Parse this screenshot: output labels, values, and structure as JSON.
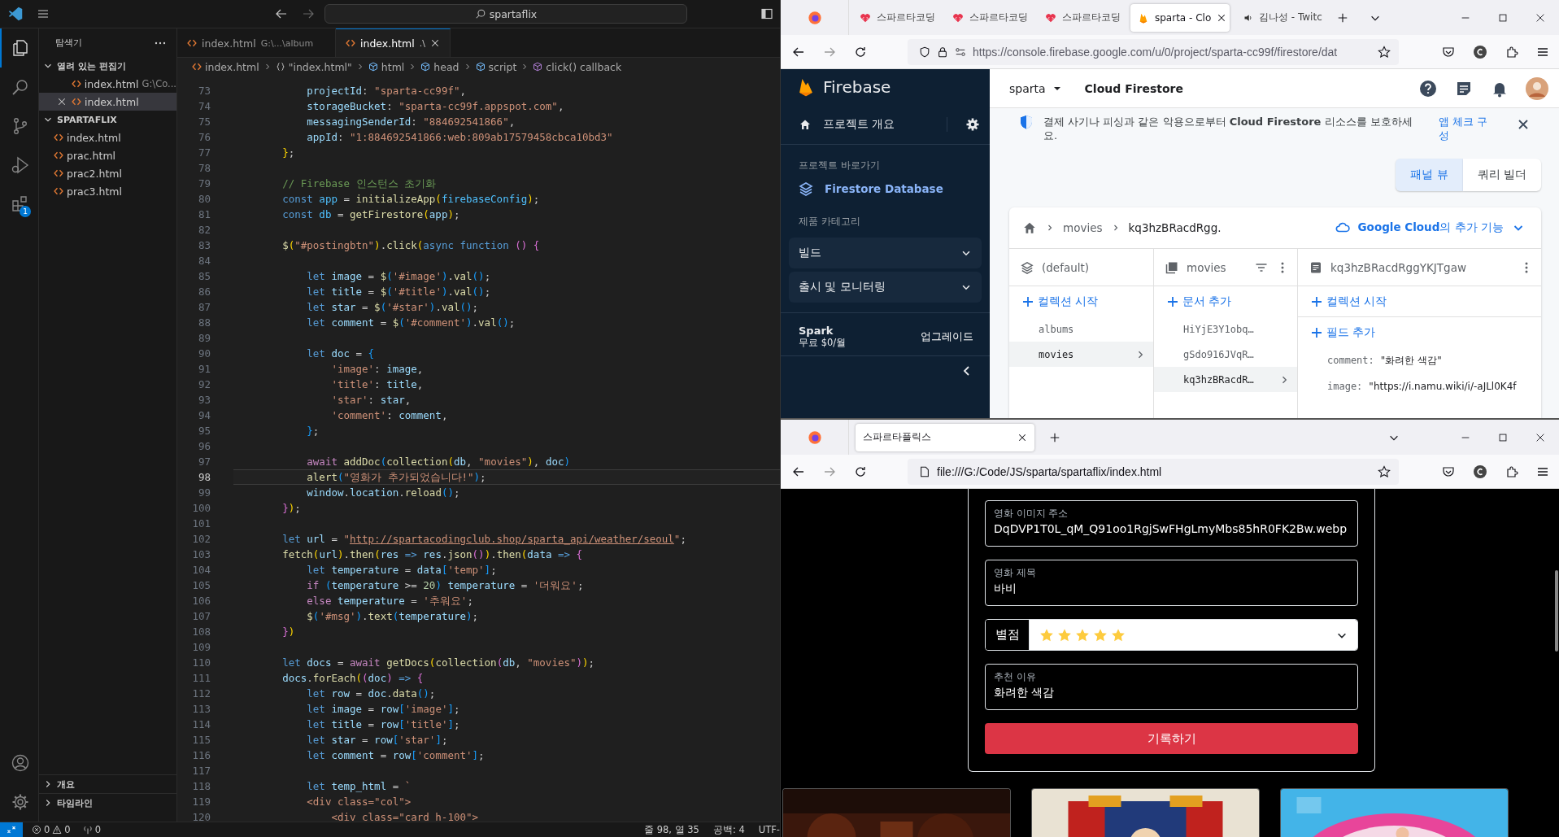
{
  "vscode": {
    "title_bar": {
      "search": "spartaflix"
    },
    "activity_bar": [
      {
        "kind": "explorer",
        "selected": true
      },
      {
        "kind": "search",
        "selected": false
      },
      {
        "kind": "source-control",
        "selected": false
      },
      {
        "kind": "run-debug",
        "selected": false
      },
      {
        "kind": "extensions",
        "selected": false,
        "badge": "1"
      }
    ],
    "activity_bar_bottom": [
      {
        "kind": "account"
      },
      {
        "kind": "settings"
      }
    ],
    "explorer": {
      "title": "탐색기",
      "open_editors": {
        "label": "열려 있는 편집기",
        "expanded": true,
        "items": [
          {
            "name": "index.html",
            "path": "G:\\Co...",
            "selected": false
          },
          {
            "name": "index.html",
            "selected": true
          }
        ]
      },
      "folder": {
        "label": "SPARTAFLIX",
        "expanded": true,
        "files": [
          "index.html",
          "prac.html",
          "prac2.html",
          "prac3.html"
        ]
      },
      "bottom_sections": [
        {
          "label": "개요",
          "expanded": false
        },
        {
          "label": "타임라인",
          "expanded": false
        }
      ]
    },
    "tabs": [
      {
        "name": "index.html",
        "path": "G:\\...\\album",
        "selected": false
      },
      {
        "name": "index.html",
        "path": ".\\",
        "selected": true
      }
    ],
    "breadcrumbs": [
      {
        "kind": "file",
        "label": "index.html"
      },
      {
        "kind": "object",
        "label": "\"index.html\""
      },
      {
        "kind": "element",
        "label": "html"
      },
      {
        "kind": "element",
        "label": "head"
      },
      {
        "kind": "element",
        "label": "script"
      },
      {
        "kind": "method",
        "label": "click() callback"
      }
    ],
    "code": [
      {
        "number": "73",
        "current": false,
        "tokens": [
          {
            "kind": "var",
            "text": "            projectId"
          },
          {
            "kind": "p",
            "text": ": "
          },
          {
            "kind": "str",
            "text": "\"sparta-cc99f\""
          },
          {
            "kind": "p",
            "text": ","
          }
        ]
      },
      {
        "number": "74",
        "current": false,
        "tokens": [
          {
            "kind": "var",
            "text": "            storageBucket"
          },
          {
            "kind": "p",
            "text": ": "
          },
          {
            "kind": "str",
            "text": "\"sparta-cc99f.appspot.com\""
          },
          {
            "kind": "p",
            "text": ","
          }
        ]
      },
      {
        "number": "75",
        "current": false,
        "tokens": [
          {
            "kind": "var",
            "text": "            messagingSenderId"
          },
          {
            "kind": "p",
            "text": ": "
          },
          {
            "kind": "str",
            "text": "\"884692541866\""
          },
          {
            "kind": "p",
            "text": ","
          }
        ]
      },
      {
        "number": "76",
        "current": false,
        "tokens": [
          {
            "kind": "var",
            "text": "            appId"
          },
          {
            "kind": "p",
            "text": ": "
          },
          {
            "kind": "str",
            "text": "\"1:884692541866:web:809ab17579458cbca10bd3\""
          }
        ]
      },
      {
        "number": "77",
        "current": false,
        "tokens": [
          {
            "kind": "b1",
            "text": "        }"
          },
          {
            "kind": "p",
            "text": ";"
          }
        ]
      },
      {
        "number": "78",
        "current": false
      },
      {
        "number": "79",
        "current": false,
        "tokens": [
          {
            "kind": "com",
            "text": "        // Firebase 인스턴스 초기화"
          }
        ]
      },
      {
        "number": "80",
        "current": false,
        "tokens": [
          {
            "kind": "kw",
            "text": "        const "
          },
          {
            "kind": "cst",
            "text": "app"
          },
          {
            "kind": "p",
            "text": " = "
          },
          {
            "kind": "fn",
            "text": "initializeApp"
          },
          {
            "kind": "b1",
            "text": "("
          },
          {
            "kind": "cst",
            "text": "firebaseConfig"
          },
          {
            "kind": "b1",
            "text": ")"
          },
          {
            "kind": "p",
            "text": ";"
          }
        ]
      },
      {
        "number": "81",
        "current": false,
        "tokens": [
          {
            "kind": "kw",
            "text": "        const "
          },
          {
            "kind": "cst",
            "text": "db"
          },
          {
            "kind": "p",
            "text": " = "
          },
          {
            "kind": "fn",
            "text": "getFirestore"
          },
          {
            "kind": "b1",
            "text": "("
          },
          {
            "kind": "var",
            "text": "app"
          },
          {
            "kind": "b1",
            "text": ")"
          },
          {
            "kind": "p",
            "text": ";"
          }
        ]
      },
      {
        "number": "82",
        "current": false
      },
      {
        "number": "83",
        "current": false,
        "tokens": [
          {
            "kind": "fn",
            "text": "        $"
          },
          {
            "kind": "b1",
            "text": "("
          },
          {
            "kind": "str",
            "text": "\"#postingbtn\""
          },
          {
            "kind": "b1",
            "text": ")"
          },
          {
            "kind": "p",
            "text": "."
          },
          {
            "kind": "fn",
            "text": "click"
          },
          {
            "kind": "b1",
            "text": "("
          },
          {
            "kind": "kw",
            "text": "async function "
          },
          {
            "kind": "b2",
            "text": "() {"
          }
        ]
      },
      {
        "number": "84",
        "current": false
      },
      {
        "number": "85",
        "current": false,
        "tokens": [
          {
            "kind": "kw",
            "text": "            let "
          },
          {
            "kind": "var",
            "text": "image"
          },
          {
            "kind": "p",
            "text": " = "
          },
          {
            "kind": "fn",
            "text": "$"
          },
          {
            "kind": "b3",
            "text": "("
          },
          {
            "kind": "str",
            "text": "'#image'"
          },
          {
            "kind": "b3",
            "text": ")"
          },
          {
            "kind": "p",
            "text": "."
          },
          {
            "kind": "fn",
            "text": "val"
          },
          {
            "kind": "b3",
            "text": "()"
          },
          {
            "kind": "p",
            "text": ";"
          }
        ]
      },
      {
        "number": "86",
        "current": false,
        "tokens": [
          {
            "kind": "kw",
            "text": "            let "
          },
          {
            "kind": "var",
            "text": "title"
          },
          {
            "kind": "p",
            "text": " = "
          },
          {
            "kind": "fn",
            "text": "$"
          },
          {
            "kind": "b3",
            "text": "("
          },
          {
            "kind": "str",
            "text": "'#title'"
          },
          {
            "kind": "b3",
            "text": ")"
          },
          {
            "kind": "p",
            "text": "."
          },
          {
            "kind": "fn",
            "text": "val"
          },
          {
            "kind": "b3",
            "text": "()"
          },
          {
            "kind": "p",
            "text": ";"
          }
        ]
      },
      {
        "number": "87",
        "current": false,
        "tokens": [
          {
            "kind": "kw",
            "text": "            let "
          },
          {
            "kind": "var",
            "text": "star"
          },
          {
            "kind": "p",
            "text": " = "
          },
          {
            "kind": "fn",
            "text": "$"
          },
          {
            "kind": "b3",
            "text": "("
          },
          {
            "kind": "str",
            "text": "'#star'"
          },
          {
            "kind": "b3",
            "text": ")"
          },
          {
            "kind": "p",
            "text": "."
          },
          {
            "kind": "fn",
            "text": "val"
          },
          {
            "kind": "b3",
            "text": "()"
          },
          {
            "kind": "p",
            "text": ";"
          }
        ]
      },
      {
        "number": "88",
        "current": false,
        "tokens": [
          {
            "kind": "kw",
            "text": "            let "
          },
          {
            "kind": "var",
            "text": "comment"
          },
          {
            "kind": "p",
            "text": " = "
          },
          {
            "kind": "fn",
            "text": "$"
          },
          {
            "kind": "b3",
            "text": "("
          },
          {
            "kind": "str",
            "text": "'#comment'"
          },
          {
            "kind": "b3",
            "text": ")"
          },
          {
            "kind": "p",
            "text": "."
          },
          {
            "kind": "fn",
            "text": "val"
          },
          {
            "kind": "b3",
            "text": "()"
          },
          {
            "kind": "p",
            "text": ";"
          }
        ]
      },
      {
        "number": "89",
        "current": false
      },
      {
        "number": "90",
        "current": false,
        "tokens": [
          {
            "kind": "kw",
            "text": "            let "
          },
          {
            "kind": "var",
            "text": "doc"
          },
          {
            "kind": "p",
            "text": " = "
          },
          {
            "kind": "b3",
            "text": "{"
          }
        ]
      },
      {
        "number": "91",
        "current": false,
        "tokens": [
          {
            "kind": "str",
            "text": "                'image'"
          },
          {
            "kind": "p",
            "text": ": "
          },
          {
            "kind": "var",
            "text": "image"
          },
          {
            "kind": "p",
            "text": ","
          }
        ]
      },
      {
        "number": "92",
        "current": false,
        "tokens": [
          {
            "kind": "str",
            "text": "                'title'"
          },
          {
            "kind": "p",
            "text": ": "
          },
          {
            "kind": "var",
            "text": "title"
          },
          {
            "kind": "p",
            "text": ","
          }
        ]
      },
      {
        "number": "93",
        "current": false,
        "tokens": [
          {
            "kind": "str",
            "text": "                'star'"
          },
          {
            "kind": "p",
            "text": ": "
          },
          {
            "kind": "var",
            "text": "star"
          },
          {
            "kind": "p",
            "text": ","
          }
        ]
      },
      {
        "number": "94",
        "current": false,
        "tokens": [
          {
            "kind": "str",
            "text": "                'comment'"
          },
          {
            "kind": "p",
            "text": ": "
          },
          {
            "kind": "var",
            "text": "comment"
          },
          {
            "kind": "p",
            "text": ","
          }
        ]
      },
      {
        "number": "95",
        "current": false,
        "tokens": [
          {
            "kind": "b3",
            "text": "            }"
          },
          {
            "kind": "p",
            "text": ";"
          }
        ]
      },
      {
        "number": "96",
        "current": false
      },
      {
        "number": "97",
        "current": false,
        "tokens": [
          {
            "kind": "ctl",
            "text": "            await "
          },
          {
            "kind": "fn",
            "text": "addDoc"
          },
          {
            "kind": "b3",
            "text": "("
          },
          {
            "kind": "fn",
            "text": "collection"
          },
          {
            "kind": "b1",
            "text": "("
          },
          {
            "kind": "var",
            "text": "db"
          },
          {
            "kind": "p",
            "text": ", "
          },
          {
            "kind": "str",
            "text": "\"movies\""
          },
          {
            "kind": "b1",
            "text": ")"
          },
          {
            "kind": "p",
            "text": ", "
          },
          {
            "kind": "var",
            "text": "doc"
          },
          {
            "kind": "b3",
            "text": ")"
          }
        ]
      },
      {
        "number": "98",
        "current": true,
        "tokens": [
          {
            "kind": "fn",
            "text": "            alert"
          },
          {
            "kind": "b3",
            "text": "("
          },
          {
            "kind": "str",
            "text": "\"영화가 추가되었습니다!\""
          },
          {
            "kind": "b3",
            "text": ")"
          },
          {
            "kind": "p",
            "text": ";"
          }
        ]
      },
      {
        "number": "99",
        "current": false,
        "tokens": [
          {
            "kind": "var",
            "text": "            window"
          },
          {
            "kind": "p",
            "text": "."
          },
          {
            "kind": "var",
            "text": "location"
          },
          {
            "kind": "p",
            "text": "."
          },
          {
            "kind": "fn",
            "text": "reload"
          },
          {
            "kind": "b3",
            "text": "()"
          },
          {
            "kind": "p",
            "text": ";"
          }
        ]
      },
      {
        "number": "100",
        "current": false,
        "tokens": [
          {
            "kind": "b2",
            "text": "        }"
          },
          {
            "kind": "b1",
            "text": ")"
          },
          {
            "kind": "p",
            "text": ";"
          }
        ]
      },
      {
        "number": "101",
        "current": false
      },
      {
        "number": "102",
        "current": false,
        "tokens": [
          {
            "kind": "kw",
            "text": "        let "
          },
          {
            "kind": "var",
            "text": "url"
          },
          {
            "kind": "p",
            "text": " = "
          },
          {
            "kind": "str",
            "text": "\""
          },
          {
            "kind": "url",
            "text": "http://spartacodingclub.shop/sparta_api/weather/seoul"
          },
          {
            "kind": "str",
            "text": "\""
          },
          {
            "kind": "p",
            "text": ";"
          }
        ]
      },
      {
        "number": "103",
        "current": false,
        "tokens": [
          {
            "kind": "fn",
            "text": "        fetch"
          },
          {
            "kind": "b1",
            "text": "("
          },
          {
            "kind": "var",
            "text": "url"
          },
          {
            "kind": "b1",
            "text": ")"
          },
          {
            "kind": "p",
            "text": "."
          },
          {
            "kind": "fn",
            "text": "then"
          },
          {
            "kind": "b1",
            "text": "("
          },
          {
            "kind": "var",
            "text": "res"
          },
          {
            "kind": "kw",
            "text": " => "
          },
          {
            "kind": "var",
            "text": "res"
          },
          {
            "kind": "p",
            "text": "."
          },
          {
            "kind": "fn",
            "text": "json"
          },
          {
            "kind": "b2",
            "text": "()"
          },
          {
            "kind": "b1",
            "text": ")"
          },
          {
            "kind": "p",
            "text": "."
          },
          {
            "kind": "fn",
            "text": "then"
          },
          {
            "kind": "b1",
            "text": "("
          },
          {
            "kind": "var",
            "text": "data"
          },
          {
            "kind": "kw",
            "text": " => "
          },
          {
            "kind": "b2",
            "text": "{"
          }
        ]
      },
      {
        "number": "104",
        "current": false,
        "tokens": [
          {
            "kind": "kw",
            "text": "            let "
          },
          {
            "kind": "var",
            "text": "temperature"
          },
          {
            "kind": "p",
            "text": " = "
          },
          {
            "kind": "var",
            "text": "data"
          },
          {
            "kind": "b3",
            "text": "["
          },
          {
            "kind": "str",
            "text": "'temp'"
          },
          {
            "kind": "b3",
            "text": "]"
          },
          {
            "kind": "p",
            "text": ";"
          }
        ]
      },
      {
        "number": "105",
        "current": false,
        "tokens": [
          {
            "kind": "ctl",
            "text": "            if "
          },
          {
            "kind": "b3",
            "text": "("
          },
          {
            "kind": "var",
            "text": "temperature"
          },
          {
            "kind": "p",
            "text": " >= "
          },
          {
            "kind": "num",
            "text": "20"
          },
          {
            "kind": "b3",
            "text": ")"
          },
          {
            "kind": "var",
            "text": " temperature"
          },
          {
            "kind": "p",
            "text": " = "
          },
          {
            "kind": "str",
            "text": "'더워요'"
          },
          {
            "kind": "p",
            "text": ";"
          }
        ]
      },
      {
        "number": "106",
        "current": false,
        "tokens": [
          {
            "kind": "ctl",
            "text": "            else "
          },
          {
            "kind": "var",
            "text": "temperature"
          },
          {
            "kind": "p",
            "text": " = "
          },
          {
            "kind": "str",
            "text": "'추워요'"
          },
          {
            "kind": "p",
            "text": ";"
          }
        ]
      },
      {
        "number": "107",
        "current": false,
        "tokens": [
          {
            "kind": "fn",
            "text": "            $"
          },
          {
            "kind": "b3",
            "text": "("
          },
          {
            "kind": "str",
            "text": "'#msg'"
          },
          {
            "kind": "b3",
            "text": ")"
          },
          {
            "kind": "p",
            "text": "."
          },
          {
            "kind": "fn",
            "text": "text"
          },
          {
            "kind": "b3",
            "text": "("
          },
          {
            "kind": "var",
            "text": "temperature"
          },
          {
            "kind": "b3",
            "text": ")"
          },
          {
            "kind": "p",
            "text": ";"
          }
        ]
      },
      {
        "number": "108",
        "current": false,
        "tokens": [
          {
            "kind": "b2",
            "text": "        }"
          },
          {
            "kind": "b1",
            "text": ")"
          }
        ]
      },
      {
        "number": "109",
        "current": false
      },
      {
        "number": "110",
        "current": false,
        "tokens": [
          {
            "kind": "kw",
            "text": "        let "
          },
          {
            "kind": "var",
            "text": "docs"
          },
          {
            "kind": "p",
            "text": " = "
          },
          {
            "kind": "ctl",
            "text": "await "
          },
          {
            "kind": "fn",
            "text": "getDocs"
          },
          {
            "kind": "b1",
            "text": "("
          },
          {
            "kind": "fn",
            "text": "collection"
          },
          {
            "kind": "b2",
            "text": "("
          },
          {
            "kind": "var",
            "text": "db"
          },
          {
            "kind": "p",
            "text": ", "
          },
          {
            "kind": "str",
            "text": "\"movies\""
          },
          {
            "kind": "b2",
            "text": ")"
          },
          {
            "kind": "b1",
            "text": ")"
          },
          {
            "kind": "p",
            "text": ";"
          }
        ]
      },
      {
        "number": "111",
        "current": false,
        "tokens": [
          {
            "kind": "var",
            "text": "        docs"
          },
          {
            "kind": "p",
            "text": "."
          },
          {
            "kind": "fn",
            "text": "forEach"
          },
          {
            "kind": "b1",
            "text": "("
          },
          {
            "kind": "b2",
            "text": "("
          },
          {
            "kind": "var",
            "text": "doc"
          },
          {
            "kind": "b2",
            "text": ")"
          },
          {
            "kind": "kw",
            "text": " => "
          },
          {
            "kind": "b2",
            "text": "{"
          }
        ]
      },
      {
        "number": "112",
        "current": false,
        "tokens": [
          {
            "kind": "kw",
            "text": "            let "
          },
          {
            "kind": "var",
            "text": "row"
          },
          {
            "kind": "p",
            "text": " = "
          },
          {
            "kind": "var",
            "text": "doc"
          },
          {
            "kind": "p",
            "text": "."
          },
          {
            "kind": "fn",
            "text": "data"
          },
          {
            "kind": "b3",
            "text": "()"
          },
          {
            "kind": "p",
            "text": ";"
          }
        ]
      },
      {
        "number": "113",
        "current": false,
        "tokens": [
          {
            "kind": "kw",
            "text": "            let "
          },
          {
            "kind": "var",
            "text": "image"
          },
          {
            "kind": "p",
            "text": " = "
          },
          {
            "kind": "var",
            "text": "row"
          },
          {
            "kind": "b3",
            "text": "["
          },
          {
            "kind": "str",
            "text": "'image'"
          },
          {
            "kind": "b3",
            "text": "]"
          },
          {
            "kind": "p",
            "text": ";"
          }
        ]
      },
      {
        "number": "114",
        "current": false,
        "tokens": [
          {
            "kind": "kw",
            "text": "            let "
          },
          {
            "kind": "var",
            "text": "title"
          },
          {
            "kind": "p",
            "text": " = "
          },
          {
            "kind": "var",
            "text": "row"
          },
          {
            "kind": "b3",
            "text": "["
          },
          {
            "kind": "str",
            "text": "'title'"
          },
          {
            "kind": "b3",
            "text": "]"
          },
          {
            "kind": "p",
            "text": ";"
          }
        ]
      },
      {
        "number": "115",
        "current": false,
        "tokens": [
          {
            "kind": "kw",
            "text": "            let "
          },
          {
            "kind": "var",
            "text": "star"
          },
          {
            "kind": "p",
            "text": " = "
          },
          {
            "kind": "var",
            "text": "row"
          },
          {
            "kind": "b3",
            "text": "["
          },
          {
            "kind": "str",
            "text": "'star'"
          },
          {
            "kind": "b3",
            "text": "]"
          },
          {
            "kind": "p",
            "text": ";"
          }
        ]
      },
      {
        "number": "116",
        "current": false,
        "tokens": [
          {
            "kind": "kw",
            "text": "            let "
          },
          {
            "kind": "var",
            "text": "comment"
          },
          {
            "kind": "p",
            "text": " = "
          },
          {
            "kind": "var",
            "text": "row"
          },
          {
            "kind": "b3",
            "text": "["
          },
          {
            "kind": "str",
            "text": "'comment'"
          },
          {
            "kind": "b3",
            "text": "]"
          },
          {
            "kind": "p",
            "text": ";"
          }
        ]
      },
      {
        "number": "117",
        "current": false
      },
      {
        "number": "118",
        "current": false,
        "tokens": [
          {
            "kind": "kw",
            "text": "            let "
          },
          {
            "kind": "var",
            "text": "temp_html"
          },
          {
            "kind": "p",
            "text": " = "
          },
          {
            "kind": "str",
            "text": "`"
          }
        ]
      },
      {
        "number": "119",
        "current": false,
        "tokens": [
          {
            "kind": "str",
            "text": "            <div class=\"col\">"
          }
        ]
      },
      {
        "number": "120",
        "current": false,
        "tokens": [
          {
            "kind": "str",
            "text": "                <div class=\"card h-100\">"
          }
        ]
      }
    ],
    "status_bar": {
      "errors": "0",
      "warnings": "0",
      "ports": "0",
      "position": "줄 98, 열 35",
      "indent": "공백: 4",
      "encoding": "UTF-"
    }
  },
  "firebase_window": {
    "tabs": [
      {
        "title": "스파르타코딩",
        "kind": "site",
        "selected": false
      },
      {
        "title": "스파르타코딩",
        "kind": "site",
        "selected": false
      },
      {
        "title": "스파르타코딩",
        "kind": "site",
        "selected": false
      },
      {
        "title": "sparta - Clo",
        "kind": "console",
        "selected": true
      },
      {
        "title": "김나성 - Twitc",
        "kind": "playing",
        "selected": false
      }
    ],
    "url": "https://console.firebase.google.com/u/0/project/sparta-cc99f/firestore/dat",
    "sidebar": {
      "brand": "Firebase",
      "overview": "프로젝트 개요",
      "shortcuts_label": "프로젝트 바로가기",
      "shortcut": "Firestore Database",
      "category_label": "제품 카테고리",
      "categories": [
        {
          "label": "빌드",
          "expanded": false
        },
        {
          "label": "출시 및 모니터링",
          "expanded": false
        }
      ],
      "plan": {
        "name": "Spark",
        "price": "무료 $0/월",
        "action": "업그레이드"
      }
    },
    "header": {
      "project": "sparta",
      "product": "Cloud Firestore"
    },
    "banner": {
      "text": "결제 사기나 피싱과 같은 악용으로부터 **Cloud Firestore** 리소스를 보호하세요.",
      "link": "앱 체크 구성"
    },
    "view_toggle": [
      {
        "label": "패널 뷰",
        "selected": true
      },
      {
        "label": "쿼리 빌더",
        "selected": false
      }
    ],
    "data_panel": {
      "path": [
        "movies",
        "kq3hzBRacdRgg."
      ],
      "extras": "**Google Cloud**의 추가 기능",
      "columns": [
        {
          "kind": "root",
          "title": "(default)",
          "action": "컬렉션 시작",
          "items": [
            {
              "label": "albums",
              "selected": false
            },
            {
              "label": "movies",
              "selected": true
            }
          ]
        },
        {
          "kind": "collection",
          "title": "movies",
          "action": "문서 추가",
          "items": [
            {
              "label": "HiYjE3Y1obq…",
              "selected": false
            },
            {
              "label": "gSdo916JVqR…",
              "selected": false
            },
            {
              "label": "kq3hzBRacdR…",
              "selected": true
            }
          ]
        },
        {
          "kind": "document",
          "title": "kq3hzBRacdRggYKJTgaw",
          "action": "컬렉션 시작",
          "field_action": "필드 추가",
          "fields": [
            {
              "key": "comment:",
              "value": "\"화려한 색감\""
            },
            {
              "key": "image:",
              "value": "\"https://i.namu.wiki/i/-aJLl0K4f"
            }
          ]
        }
      ]
    }
  },
  "app_window": {
    "tab": {
      "title": "스파르타플릭스",
      "selected": true
    },
    "url": "file:///G:/Code/JS/sparta/spartaflix/index.html",
    "form": {
      "fields": [
        {
          "kind": "text",
          "label": "영화 이미지 주소",
          "value": "DqDVP1T0L_qM_Q91oo1RgjSwFHgLmyMbs85hR0FK2Bw.webp"
        },
        {
          "kind": "text",
          "label": "영화 제목",
          "value": "바비"
        },
        {
          "kind": "select",
          "label": "별점",
          "stars": 5
        },
        {
          "kind": "text",
          "label": "추천 이유",
          "value": "화려한 색감"
        }
      ],
      "submit": "기록하기"
    }
  }
}
